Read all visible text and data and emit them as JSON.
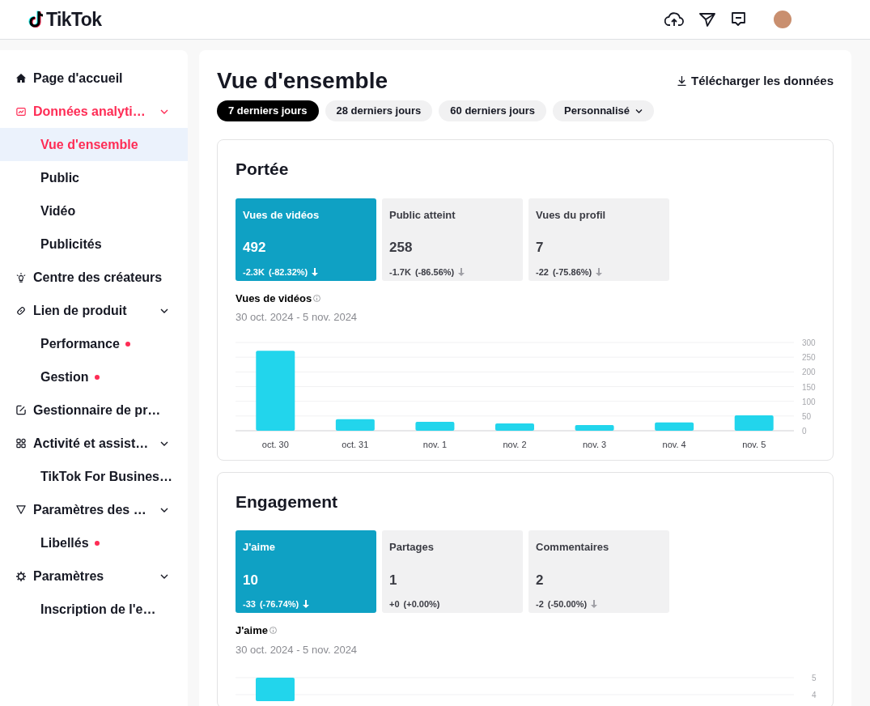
{
  "header": {
    "logo": "TikTok"
  },
  "sidebar": {
    "items": [
      {
        "label": "Page d'accueil",
        "selected": false
      },
      {
        "label": "Données analyti…",
        "expanded": true,
        "selected": false,
        "children": [
          {
            "label": "Vue d'ensemble",
            "selected": true,
            "alert": false
          },
          {
            "label": "Public",
            "selected": false,
            "alert": false
          },
          {
            "label": "Vidéo",
            "selected": false,
            "alert": false
          },
          {
            "label": "Publicités",
            "selected": false,
            "alert": false
          }
        ]
      },
      {
        "label": "Centre des créateurs",
        "selected": false
      },
      {
        "label": "Lien de produit",
        "expanded": true,
        "selected": false,
        "children": [
          {
            "label": "Performance",
            "selected": false,
            "alert": true
          },
          {
            "label": "Gestion",
            "selected": false,
            "alert": true
          }
        ]
      },
      {
        "label": "Gestionnaire de pr…",
        "selected": false
      },
      {
        "label": "Activité et assist…",
        "expanded": true,
        "selected": false,
        "children": [
          {
            "label": "TikTok For Busines…",
            "selected": false,
            "alert": false
          }
        ]
      },
      {
        "label": "Paramètres des …",
        "expanded": true,
        "selected": false,
        "children": [
          {
            "label": "Libellés",
            "selected": false,
            "alert": true
          }
        ]
      },
      {
        "label": "Paramètres",
        "expanded": true,
        "selected": false,
        "children": [
          {
            "label": "Inscription de l'e…",
            "selected": false,
            "alert": false
          }
        ]
      }
    ]
  },
  "page": {
    "title": "Vue d'ensemble",
    "download": "Télécharger les données",
    "periods": [
      {
        "label": "7 derniers jours",
        "selected": true,
        "kind": "pill"
      },
      {
        "label": "28 derniers jours",
        "selected": false,
        "kind": "pill"
      },
      {
        "label": "60 derniers jours",
        "selected": false,
        "kind": "pill"
      },
      {
        "label": "Personnalisé",
        "selected": false,
        "kind": "dropdown"
      }
    ]
  },
  "sections": [
    {
      "title": "Portée",
      "metrics": [
        {
          "label": "Vues de vidéos",
          "value": "492",
          "change": "-2.3K",
          "percent": "(-82.32%)",
          "decrease": true,
          "selected": true
        },
        {
          "label": "Public atteint",
          "value": "258",
          "change": "-1.7K",
          "percent": "(-86.56%)",
          "decrease": true,
          "selected": false
        },
        {
          "label": "Vues du profil",
          "value": "7",
          "change": "-22",
          "percent": "(-75.86%)",
          "decrease": true,
          "selected": false
        }
      ],
      "chart_title": "Vues de vidéos",
      "date_range": "30 oct. 2024 - 5 nov. 2024",
      "chart_data": {
        "type": "bar",
        "categories": [
          "oct. 30",
          "oct. 31",
          "nov. 1",
          "nov. 2",
          "nov. 3",
          "nov. 4",
          "nov. 5"
        ],
        "grid": true,
        "series": [
          {
            "color": "#22d5ec",
            "values": [
              272,
              39,
              30,
              25,
              19,
              28,
              52
            ]
          }
        ],
        "ylim": [
          0,
          300
        ],
        "yticks": [
          0,
          50,
          100,
          150,
          200,
          250,
          300
        ]
      }
    },
    {
      "title": "Engagement",
      "metrics": [
        {
          "label": "J'aime",
          "value": "10",
          "change": "-33",
          "percent": "(-76.74%)",
          "decrease": true,
          "selected": true
        },
        {
          "label": "Partages",
          "value": "1",
          "change": "+0",
          "percent": "(+0.00%)",
          "decrease": false,
          "selected": false
        },
        {
          "label": "Commentaires",
          "value": "2",
          "change": "-2",
          "percent": "(-50.00%)",
          "decrease": true,
          "selected": false
        }
      ],
      "chart_title": "J'aime",
      "date_range": "30 oct. 2024 - 5 nov. 2024",
      "axis_labels": [
        "5",
        "4"
      ]
    }
  ]
}
